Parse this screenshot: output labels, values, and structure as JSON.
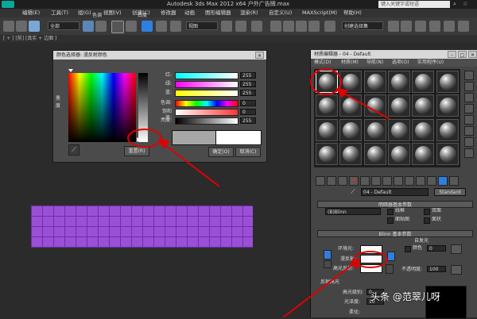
{
  "app": {
    "title": "Autodesk 3ds Max  2012 x64   户外广告牌.max",
    "search_placeholder": "键入关键字或短语"
  },
  "menubar": {
    "items": [
      "编辑(E)",
      "工具(T)",
      "组(G)",
      "视图(V)",
      "创建(C)",
      "修改器",
      "动画",
      "图形编辑器",
      "渲染(R)",
      "自定义(U)",
      "MAXScript(M)",
      "帮助(H)"
    ]
  },
  "toolbar": {
    "filter_select": "全部",
    "view_select": "视图",
    "named_selection_select": "创建选择集"
  },
  "viewport": {
    "label": "[ + ] [前] [真实 + 边面 ]"
  },
  "color_dialog": {
    "title": "颜色选择器: 漫反射颜色",
    "hue_label": "色调",
    "whiteness_label": "白度",
    "blackness_label": "黑度",
    "sliders": [
      {
        "label": "红:",
        "value": "255",
        "gradient": "linear-gradient(to right,#00ffff,#ffffff)"
      },
      {
        "label": "绿:",
        "value": "255",
        "gradient": "linear-gradient(to right,#ff00ff,#ffffff)"
      },
      {
        "label": "蓝:",
        "value": "255",
        "gradient": "linear-gradient(to right,#ffff00,#ffffff)"
      },
      {
        "label": "色调:",
        "value": "0",
        "gradient": "linear-gradient(to right,#ff0000,#ffff00,#00ff00,#00ffff,#0000ff,#ff00ff,#ff0000)"
      },
      {
        "label": "饱和度:",
        "value": "0",
        "gradient": "linear-gradient(to right,#ffffff,#ff3333)"
      },
      {
        "label": "亮度:",
        "value": "255",
        "gradient": "linear-gradient(to right,#000000,#ffffff)"
      }
    ],
    "reset_label": "重置(R)",
    "ok_label": "确定(O)",
    "cancel_label": "取消(C)"
  },
  "material_editor": {
    "title": "材质编辑器 - 04 - Default",
    "menu": [
      "模式(D)",
      "材质(M)",
      "导航(N)",
      "选项(O)",
      "实用程序(U)"
    ],
    "material_name": "04 - Default",
    "material_type": "Standard",
    "rollout_shader_basic": "明暗器基本参数",
    "shader_select": "(B)Blinn",
    "shader_options": [
      "线框",
      "双面",
      "面贴图",
      "面状"
    ],
    "rollout_blinn_basic": "Blinn 基本参数",
    "self_illum_label": "自发光",
    "color_checkbox_label": "颜色",
    "self_illum_value": "0",
    "ambient_label": "环境光:",
    "diffuse_label": "漫反射:",
    "specular_label": "高光反射:",
    "opacity_label": "不透明度:",
    "opacity_value": "100",
    "specular_highlights_label": "反射高光",
    "specular_level_label": "高光级别:",
    "specular_level_value": "0",
    "glossiness_label": "光泽度:",
    "glossiness_value": "10",
    "soften_label": "柔化:"
  },
  "watermark": "头条 @范翠儿呀",
  "colors": {
    "annotation_red": "#e00000",
    "object_purple": "#9b4fd6"
  }
}
